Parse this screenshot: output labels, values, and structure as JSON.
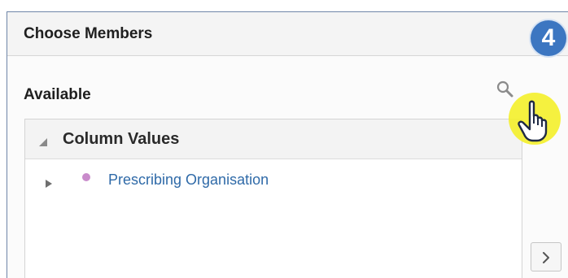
{
  "panel": {
    "title": "Choose Members"
  },
  "step_badge": "4",
  "available": {
    "label": "Available",
    "search_icon": "search-icon"
  },
  "tree": {
    "header_label": "Column Values",
    "items": [
      {
        "label": "Prescribing Organisation",
        "dot_color": "#c98bcb"
      }
    ]
  },
  "controls": {
    "move_right_icon": "chevron-right-icon"
  },
  "colors": {
    "badge": "#3c76c1",
    "cursor_highlight": "#f4f02a",
    "link": "#2f6aa8"
  }
}
